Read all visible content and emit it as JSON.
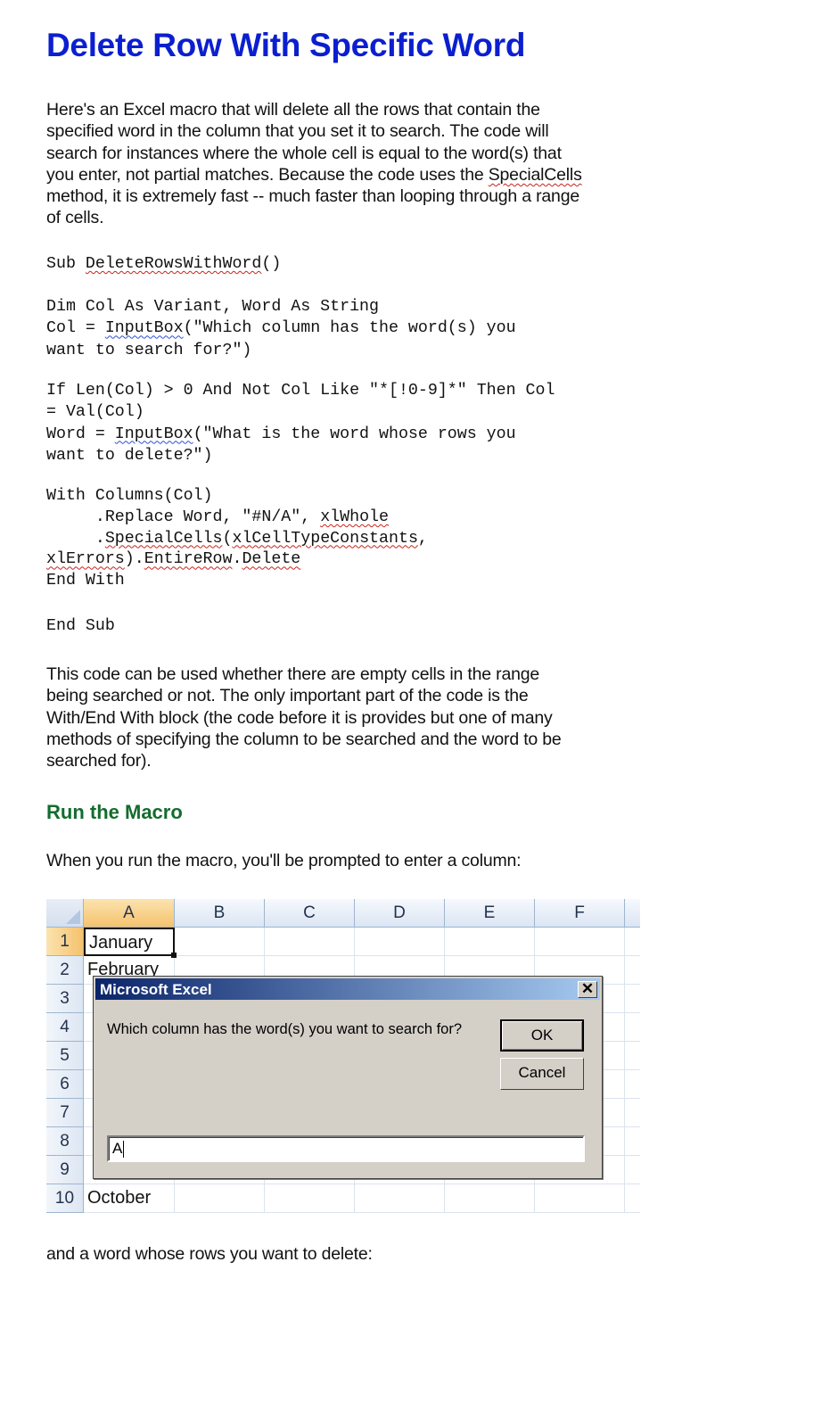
{
  "title": "Delete Row With Specific Word",
  "intro": {
    "l1": "Here's an Excel macro that will delete all the rows that contain the",
    "l2": "specified word in the column that you set it to search. The code will",
    "l3": "search for instances where the whole cell is equal to the word(s) that",
    "l4a": "you enter, not partial matches. Because the code uses the ",
    "l4b": "SpecialCells",
    "l5": "method, it is extremely fast -- much faster than looping through a range",
    "l6": "of cells."
  },
  "code": {
    "block1": [
      "Sub ",
      "DeleteRowsWithWord",
      "()"
    ],
    "block2": [
      [
        "Dim Col As Variant, Word As String"
      ],
      [
        "Col = ",
        "InputBox",
        "(\"Which column has the word(s) you"
      ],
      [
        "want to search for?\")"
      ]
    ],
    "block3": [
      [
        "If Len(Col) > 0 And Not Col Like \"*[!0-9]*\" Then Col"
      ],
      [
        "= Val(Col)"
      ],
      [
        "Word = ",
        "InputBox",
        "(\"What is the word whose rows you"
      ],
      [
        "want to delete?\")"
      ]
    ],
    "block4": {
      "l1": "With Columns(Col)",
      "l2a": "     .Replace Word, \"#N/A\", ",
      "l2b": "xlWhole",
      "l3a": "     .",
      "l3b": "SpecialCells",
      "l3c": "(",
      "l3d": "xlCellTypeConstants",
      "l3e": ",",
      "l4a": "xlErrors",
      "l4b": ").",
      "l4c": "EntireRow",
      "l4d": ".",
      "l4e": "Delete",
      "l5": "End With"
    },
    "block5": "End Sub"
  },
  "note": [
    "This code can be used whether there are empty cells in the range",
    "being searched or not. The only important part of the code is the",
    "With/End With block (the code before it is provides but one of many",
    "methods of specifying the column to be searched and the word to be",
    "searched for)."
  ],
  "section_heading": "Run the Macro",
  "prompt1": "When you run the macro, you'll be prompted to enter a column:",
  "excel": {
    "columns": [
      "A",
      "B",
      "C",
      "D",
      "E",
      "F"
    ],
    "rows": [
      "1",
      "2",
      "3",
      "4",
      "5",
      "6",
      "7",
      "8",
      "9",
      "10"
    ],
    "cells": [
      "January",
      "February",
      "",
      "",
      "",
      "",
      "",
      "",
      "",
      "October"
    ],
    "dialog": {
      "title": "Microsoft Excel",
      "close": "✕",
      "message": "Which column has the word(s) you want to search for?",
      "ok": "OK",
      "cancel": "Cancel",
      "input_value": "A"
    }
  },
  "prompt2": "and a word whose rows you want to delete:"
}
